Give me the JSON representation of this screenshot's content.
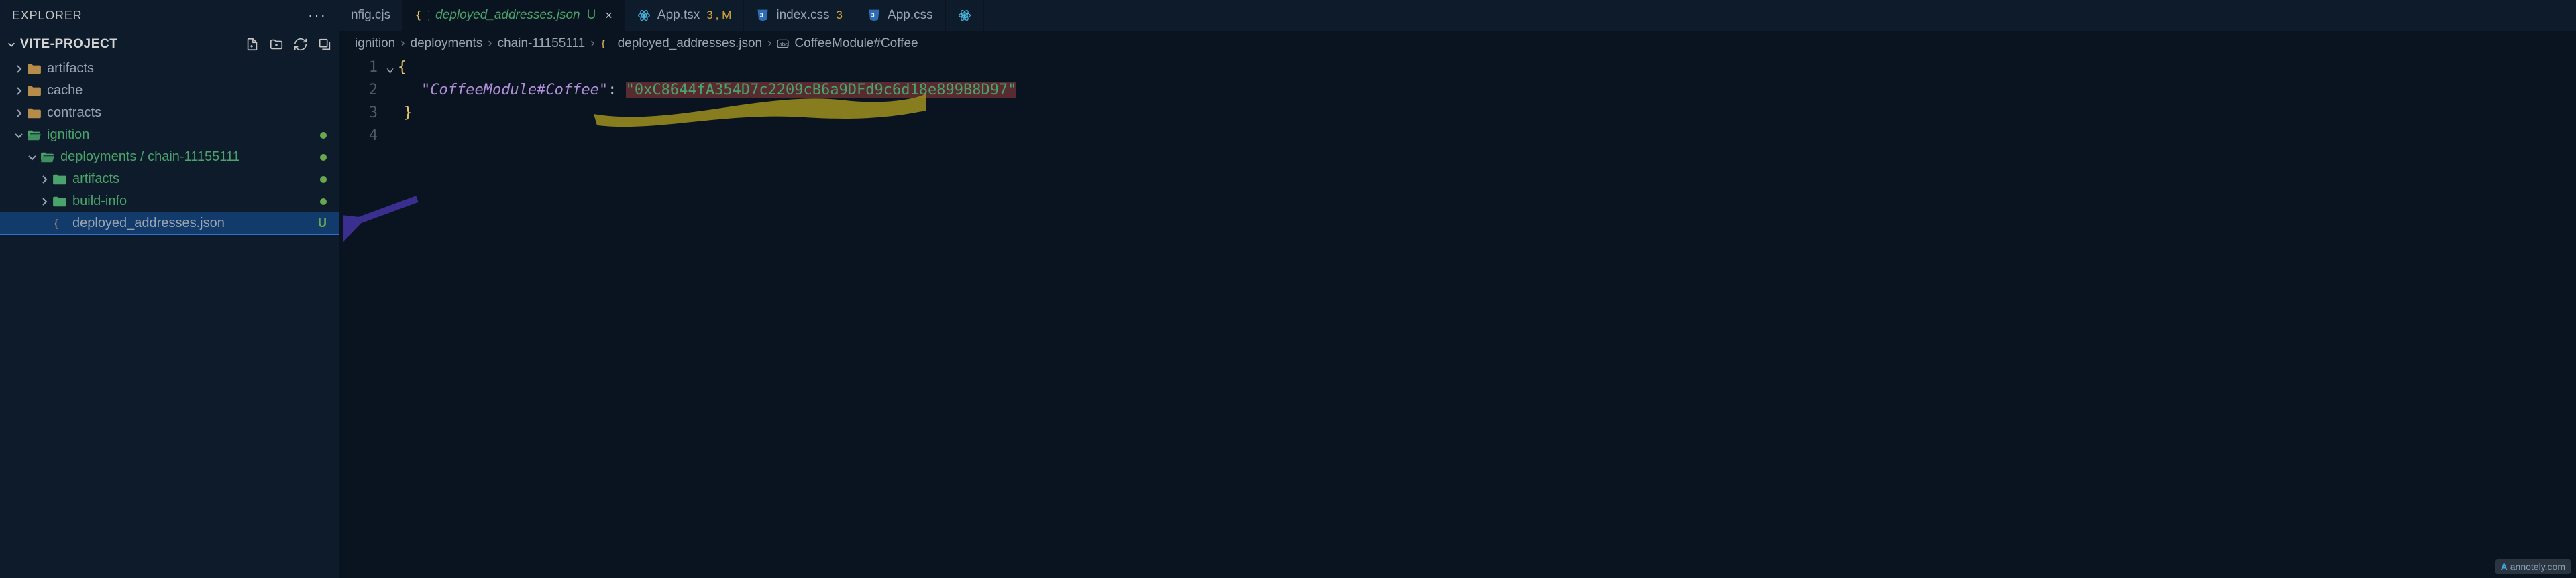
{
  "sidebar": {
    "title": "EXPLORER",
    "project": "VITE-PROJECT",
    "tree": [
      {
        "name": "artifacts",
        "type": "folder",
        "indent": 0,
        "open": false,
        "color": "default"
      },
      {
        "name": "cache",
        "type": "folder",
        "indent": 0,
        "open": false,
        "color": "default"
      },
      {
        "name": "contracts",
        "type": "folder",
        "indent": 0,
        "open": false,
        "color": "default"
      },
      {
        "name": "ignition",
        "type": "folder",
        "indent": 0,
        "open": true,
        "color": "green",
        "dot": true
      },
      {
        "name": "deployments / chain-11155111",
        "type": "folder",
        "indent": 1,
        "open": true,
        "color": "green",
        "dot": true
      },
      {
        "name": "artifacts",
        "type": "folder",
        "indent": 2,
        "open": false,
        "color": "green",
        "dot": true
      },
      {
        "name": "build-info",
        "type": "folder",
        "indent": 2,
        "open": false,
        "color": "green",
        "dot": true
      },
      {
        "name": "deployed_addresses.json",
        "type": "file",
        "indent": 2,
        "selected": true,
        "status": "U",
        "icon": "json"
      }
    ]
  },
  "tabs": [
    {
      "icon": "",
      "label": "nfig.cjs",
      "partial": true
    },
    {
      "icon": "json",
      "label": "deployed_addresses.json",
      "italic": true,
      "color": "green",
      "status": "U",
      "close": true,
      "active": true
    },
    {
      "icon": "react",
      "label": "App.tsx",
      "badgeNum": "3",
      "badgeM": ", M"
    },
    {
      "icon": "css",
      "label": "index.css",
      "badgeNum": "3"
    },
    {
      "icon": "css",
      "label": "App.css"
    },
    {
      "icon": "react-partial",
      "label": ""
    }
  ],
  "breadcrumb": {
    "parts": [
      "ignition",
      "deployments",
      "chain-11155111"
    ],
    "file": "deployed_addresses.json",
    "symbol": "CoffeeModule#Coffee"
  },
  "code": {
    "lines": [
      "1",
      "2",
      "3",
      "4"
    ],
    "key": "\"CoffeeModule#Coffee\"",
    "value": "\"0xC8644fA354D7c2209cB6a9DFd9c6d18e899B8D97\"",
    "indent": "    "
  },
  "watermark": "annotely.com"
}
